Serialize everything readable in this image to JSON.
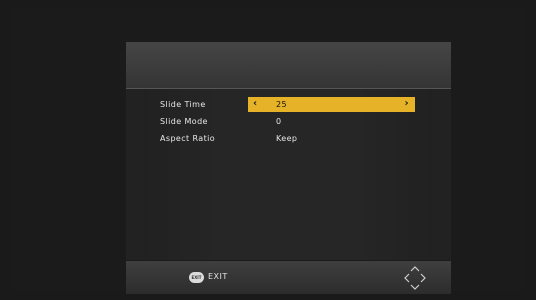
{
  "menu": {
    "rows": [
      {
        "label": "Slide Time",
        "value": "25",
        "selected": true
      },
      {
        "label": "Slide Mode",
        "value": "0",
        "selected": false
      },
      {
        "label": "Aspect Ratio",
        "value": "Keep",
        "selected": false
      }
    ]
  },
  "footer": {
    "exit_button_text": "EXIT",
    "exit_label": "EXIT",
    "nav_icon": "dpad-arrows-icon"
  },
  "colors": {
    "highlight": "#e6b227",
    "text": "#e8e8e8"
  }
}
